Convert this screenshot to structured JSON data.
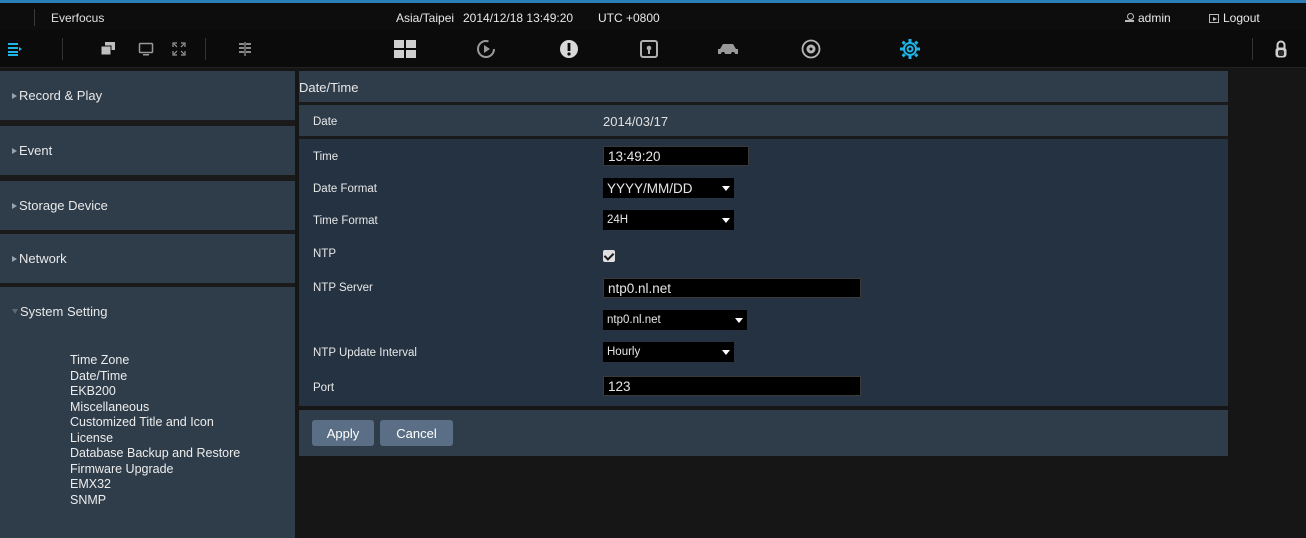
{
  "topbar": {
    "brand": "Everfocus",
    "timezone": "Asia/Taipei",
    "datetime": "2014/12/18 13:49:20",
    "utc": "UTC +0800",
    "user": "admin",
    "logout": "Logout"
  },
  "toolbar": {
    "icons": [
      "menu-icon",
      "windows-icon",
      "monitor-icon",
      "fullscreen-icon",
      "layout-split-icon",
      "grid-view-icon",
      "playback-icon",
      "alert-icon",
      "lock-box-icon",
      "vehicle-icon",
      "disk-icon",
      "settings-gear-icon",
      "lock-icon"
    ],
    "accent_color": "#1fb4e6"
  },
  "sidebar": {
    "items": [
      {
        "label": "Record & Play"
      },
      {
        "label": "Event"
      },
      {
        "label": "Storage Device"
      },
      {
        "label": "Network"
      },
      {
        "label": "System Setting"
      }
    ],
    "submenu": [
      "Time Zone",
      "Date/Time",
      "EKB200",
      "Miscellaneous",
      "Customized Title and Icon",
      "License",
      "Database Backup and Restore",
      "Firmware Upgrade",
      "EMX32",
      "SNMP"
    ]
  },
  "panel": {
    "title": "Date/Time",
    "date_label": "Date",
    "date_value": "2014/03/17",
    "time_label": "Time",
    "time_value": "13:49:20",
    "date_format_label": "Date Format",
    "date_format_value": "YYYY/MM/DD",
    "time_format_label": "Time Format",
    "time_format_value": "24H",
    "ntp_label": "NTP",
    "ntp_checked": true,
    "ntp_server_label": "NTP Server",
    "ntp_server_value": "ntp0.nl.net",
    "ntp_server_select": "ntp0.nl.net",
    "ntp_interval_label": "NTP Update Interval",
    "ntp_interval_value": "Hourly",
    "port_label": "Port",
    "port_value": "123"
  },
  "actions": {
    "apply": "Apply",
    "cancel": "Cancel"
  }
}
